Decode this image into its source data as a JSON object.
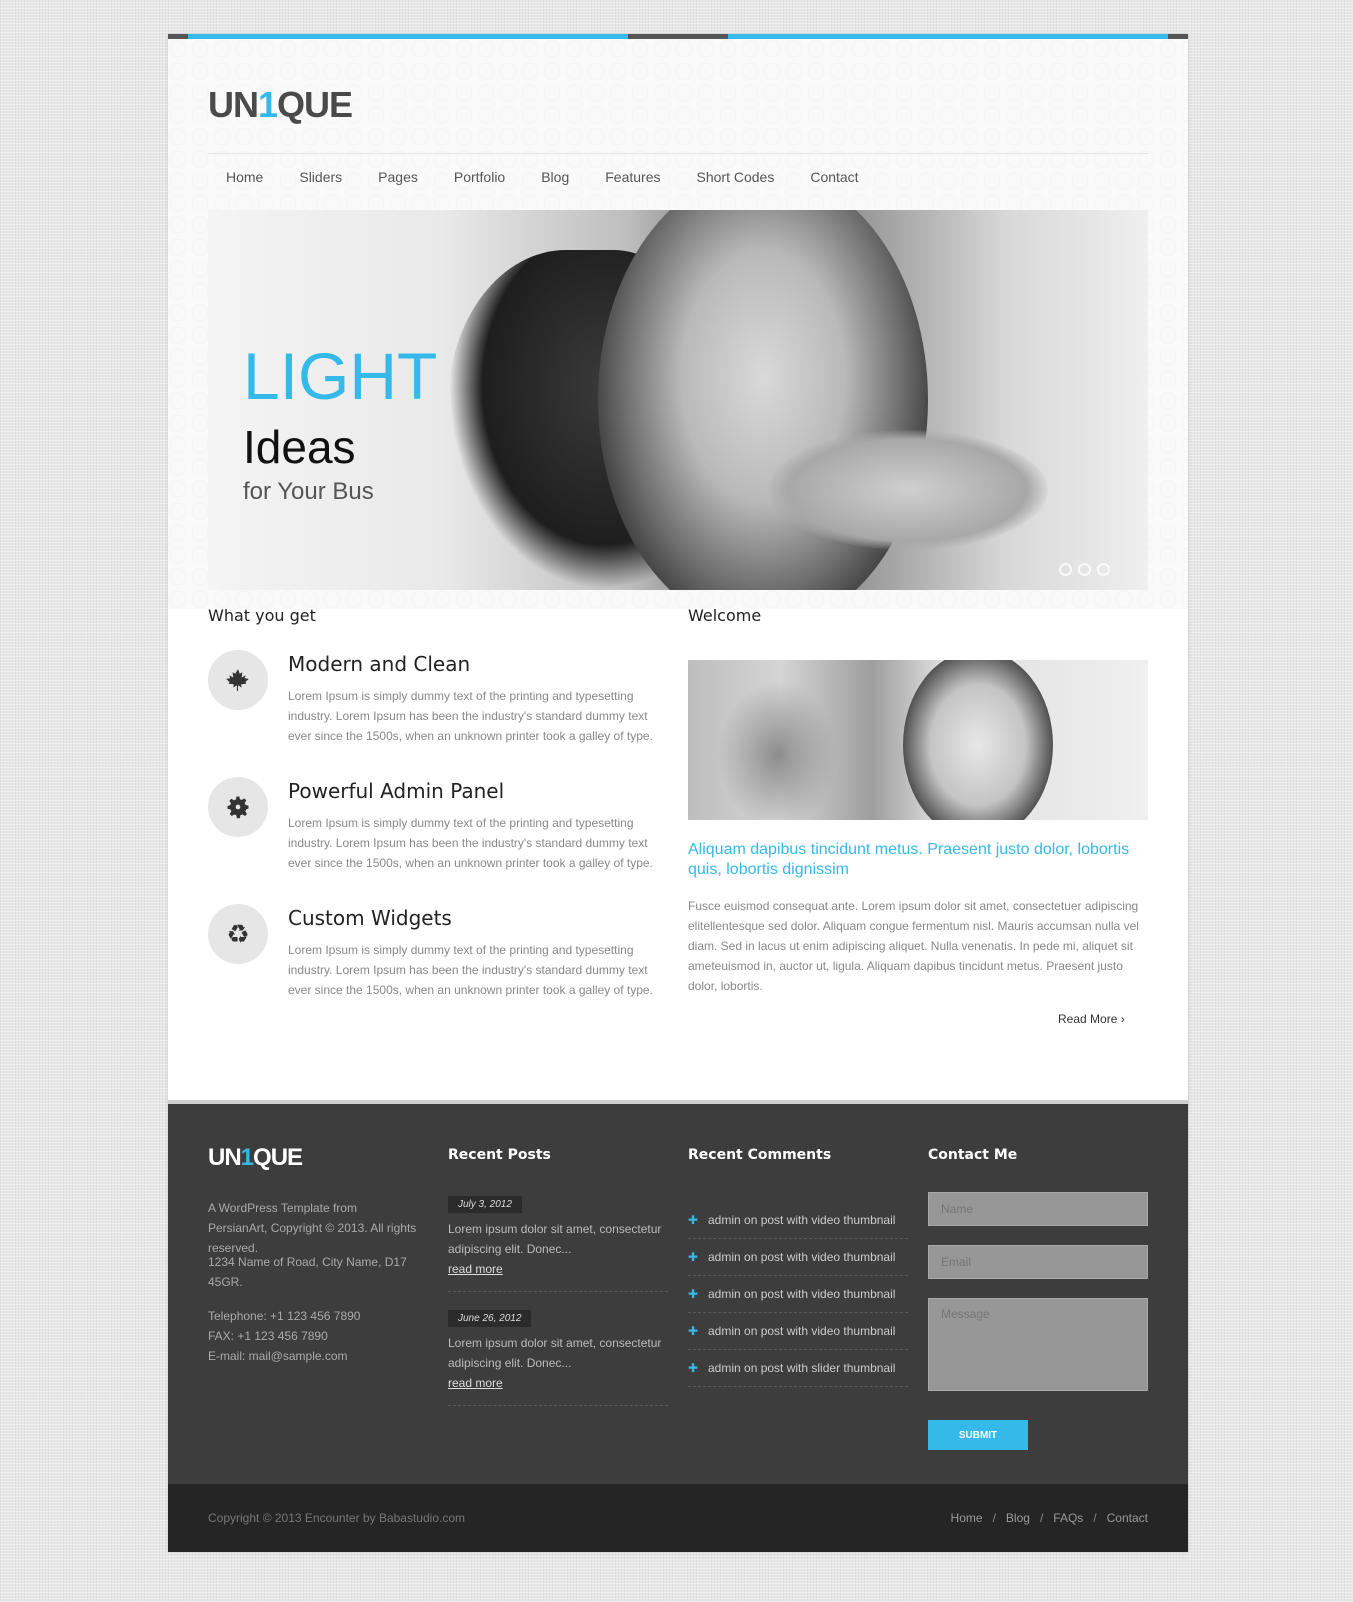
{
  "colors": {
    "accent": "#35b9e9",
    "dark_bar": "#555555",
    "footer_bg": "#3d3d3d",
    "bottom_bg": "#252525"
  },
  "logo": {
    "prefix": "UN",
    "digit": "1",
    "suffix": "QUE"
  },
  "nav": [
    "Home",
    "Sliders",
    "Pages",
    "Portfolio",
    "Blog",
    "Features",
    "Short Codes",
    "Contact"
  ],
  "slider": {
    "title": "LIGHT",
    "subtitle": "Ideas",
    "tagline": "for Your Bus",
    "dots": 3
  },
  "features": {
    "heading": "What you get",
    "items": [
      {
        "icon": "maple-leaf-icon",
        "title": "Modern and Clean",
        "text": "Lorem Ipsum is simply dummy text of the printing and typesetting industry. Lorem Ipsum has been the industry's standard dummy text ever since the 1500s, when an unknown printer took a galley of type."
      },
      {
        "icon": "gear-icon",
        "title": "Powerful Admin Panel",
        "text": "Lorem Ipsum is simply dummy text of the printing and typesetting industry. Lorem Ipsum has been the industry's standard dummy text ever since the 1500s, when an unknown printer took a galley of type."
      },
      {
        "icon": "recycle-icon",
        "title": "Custom Widgets",
        "text": "Lorem Ipsum is simply dummy text of the printing and typesetting industry. Lorem Ipsum has been the industry's standard dummy text ever since the 1500s, when an unknown printer took a galley of type."
      }
    ]
  },
  "welcome": {
    "heading": "Welcome",
    "lead": "Aliquam dapibus tincidunt metus. Praesent justo dolor, lobortis quis, lobortis dignissim",
    "text": "Fusce euismod consequat ante. Lorem ipsum dolor sit amet, consectetuer adipiscing elitellentesque sed dolor. Aliquam congue fermentum nisl. Mauris accumsan nulla vel diam. Sed in lacus ut enim adipiscing aliquet. Nulla venenatis. In pede mi, aliquet sit ameteuismod in, auctor ut, ligula. Aliquam dapibus tincidunt metus. Praesent justo dolor, lobortis.",
    "read_more": "Read More ›"
  },
  "footer": {
    "about": "A WordPress Template from PersianArt, Copyright © 2013. All rights reserved.",
    "address": "1234 Name of Road, City Name, D17 45GR.",
    "telephone": "Telephone: +1 123 456 7890",
    "fax": "FAX: +1 123 456 7890",
    "email": "E-mail: mail@sample.com",
    "recent_posts_heading": "Recent Posts",
    "posts": [
      {
        "date": "July 3, 2012",
        "text": "Lorem ipsum dolor sit amet, consectetur adipiscing elit. Donec...",
        "more": "read more"
      },
      {
        "date": "June 26, 2012",
        "text": "Lorem ipsum dolor sit amet, consectetur adipiscing elit. Donec...",
        "more": "read more"
      }
    ],
    "recent_comments_heading": "Recent Comments",
    "comments": [
      "admin on post with video thumbnail",
      "admin on post with video thumbnail",
      "admin on post with video thumbnail",
      "admin on post with video thumbnail",
      "admin on post with slider thumbnail"
    ],
    "contact_heading": "Contact Me",
    "form": {
      "name_placeholder": "Name",
      "email_placeholder": "Email",
      "message_placeholder": "Message",
      "submit": "SUBMIT"
    }
  },
  "bottom": {
    "copyright": "Copyright © 2013 Encounter by Babastudio.com",
    "links": [
      "Home",
      "Blog",
      "FAQs",
      "Contact"
    ],
    "separator": "/"
  }
}
